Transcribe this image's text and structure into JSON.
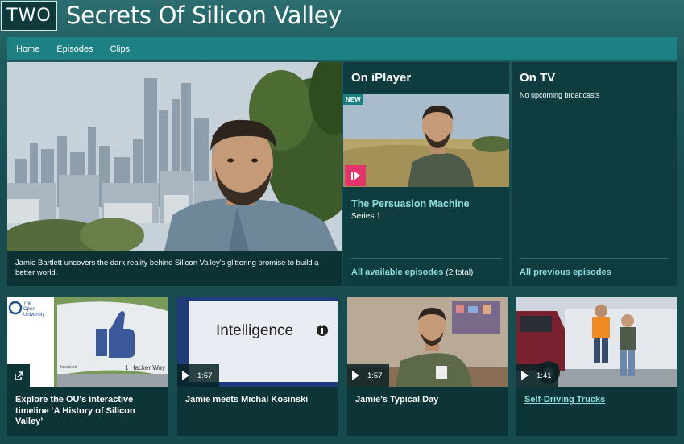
{
  "header": {
    "channel_logo": "TWO",
    "title": "Secrets Of Silicon Valley"
  },
  "nav": {
    "items": [
      "Home",
      "Episodes",
      "Clips"
    ]
  },
  "hero": {
    "caption": "Jamie Bartlett uncovers the dark reality behind Silicon Valley's glittering promise to build a better world."
  },
  "iplayer": {
    "heading": "On iPlayer",
    "badge": "NEW",
    "episode_title": "The Persuasion Machine",
    "series": "Series 1",
    "link_label": "All available episodes",
    "link_count": "(2 total)",
    "icon": "iplayer-icon"
  },
  "on_tv": {
    "heading": "On TV",
    "note": "No upcoming broadcasts",
    "link_label": "All previous episodes"
  },
  "clips": [
    {
      "title": "Explore the OU's interactive timeline ‘A History of Silicon Valley’",
      "type": "external",
      "logo_text": "The Open University",
      "sign_text": "1 Hacker Way",
      "sign_small": "facebook"
    },
    {
      "title": "Jamie meets Michal Kosinski",
      "duration": "1:57",
      "screen_text": "Intelligence"
    },
    {
      "title": "Jamie's Typical Day",
      "duration": "1:57"
    },
    {
      "title": "Self-Driving Trucks",
      "duration": "1:41"
    }
  ],
  "colors": {
    "accent": "#1d8183",
    "link": "#8fdfe0",
    "panel": "#0f3d3f",
    "iplayer_pink": "#e3356d"
  }
}
